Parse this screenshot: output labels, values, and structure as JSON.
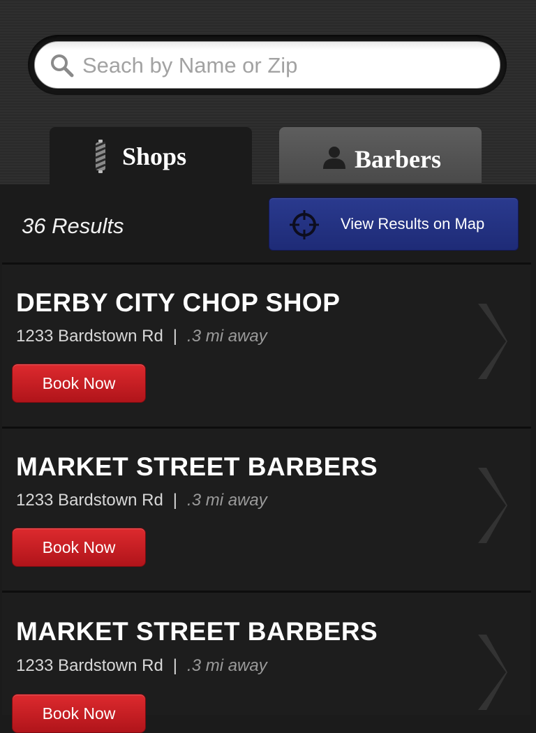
{
  "search": {
    "placeholder": "Seach by Name or Zip"
  },
  "tabs": [
    {
      "label": "Shops",
      "icon": "barber-pole-icon",
      "active": true
    },
    {
      "label": "Barbers",
      "icon": "person-icon",
      "active": false
    }
  ],
  "results": {
    "count_label": "36 Results",
    "map_button_label": "View Results on Map"
  },
  "shops": [
    {
      "name": "DERBY CITY CHOP SHOP",
      "address": "1233 Bardstown Rd",
      "separator": "|",
      "distance": ".3 mi away",
      "button": "Book Now"
    },
    {
      "name": "MARKET STREET BARBERS",
      "address": "1233 Bardstown Rd",
      "separator": "|",
      "distance": ".3 mi away",
      "button": "Book Now"
    },
    {
      "name": "MARKET STREET BARBERS",
      "address": "1233 Bardstown Rd",
      "separator": "|",
      "distance": ".3 mi away",
      "button": "Book Now"
    }
  ],
  "colors": {
    "background": "#1b1b1b",
    "map_button": "#24338a",
    "book_button": "#c91d23"
  }
}
